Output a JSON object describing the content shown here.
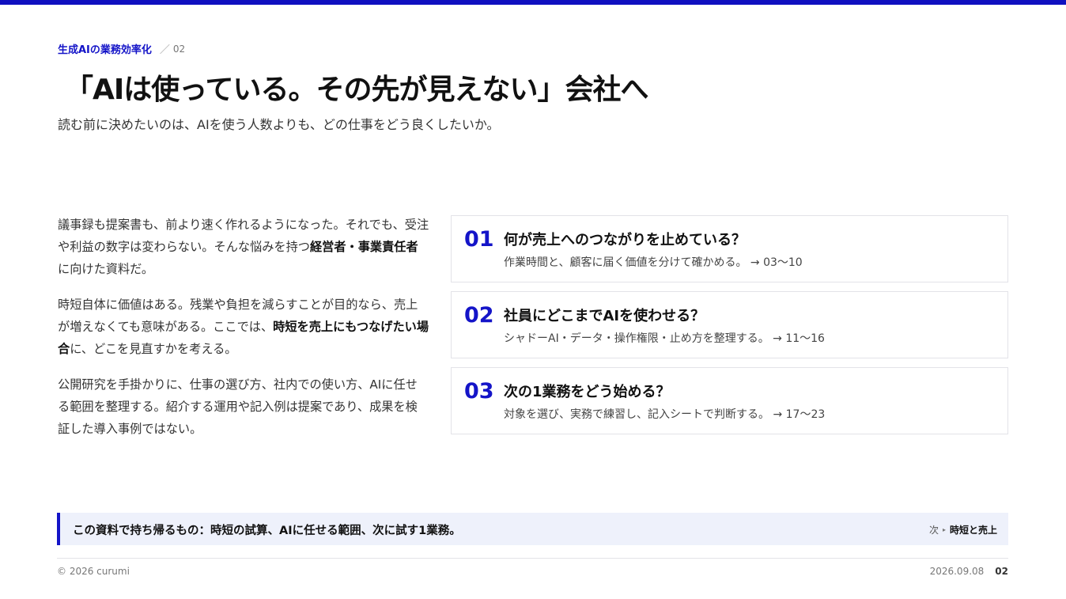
{
  "header": {
    "section_label": "生成AIの業務効率化",
    "separator": "／",
    "page_number": "02"
  },
  "title": "「AIは使っている。その先が見えない」会社へ",
  "subtitle": "読む前に決めたいのは、AIを使う人数よりも、どの仕事をどう良くしたいか。",
  "body": {
    "p1": {
      "before": "議事録も提案書も、前より速く作れるようになった。それでも、受注や利益の数字は変わらない。そんな悩みを持つ",
      "bold": "経営者・事業責任者",
      "after": "に向けた資料だ。"
    },
    "p2": {
      "before": "時短自体に価値はある。残業や負担を減らすことが目的なら、売上が増えなくても意味がある。ここでは、",
      "bold": "時短を売上にもつなげたい場合",
      "after": "に、どこを見直すかを考える。"
    },
    "p3": "公開研究を手掛かりに、仕事の選び方、社内での使い方、AIに任せる範囲を整理する。紹介する運用や記入例は提案であり、成果を検証した導入事例ではない。"
  },
  "cards": [
    {
      "number": "01",
      "question": "何が売上へのつながりを止めている？",
      "description": "作業時間と、顧客に届く価値を分けて確かめる。 → 03〜10"
    },
    {
      "number": "02",
      "question": "社員にどこまでAIを使わせる？",
      "description": "シャドーAI・データ・操作権限・止め方を整理する。 → 11〜16"
    },
    {
      "number": "03",
      "question": "次の1業務をどう始める？",
      "description": "対象を選び、実務で練習し、記入シートで判断する。 → 17〜23"
    }
  ],
  "takeaway": {
    "text": "この資料で持ち帰るもの：時短の試算、AIに任せる範囲、次に試す1業務。",
    "next_label": "次",
    "next_arrow": "▸",
    "next_target": "時短と売上"
  },
  "footer": {
    "copyright": "© 2026 curumi",
    "date": "2026.09.08",
    "page": "02"
  },
  "colors": {
    "accent": "#1414c8",
    "takeaway_bg": "#eef1fb"
  }
}
